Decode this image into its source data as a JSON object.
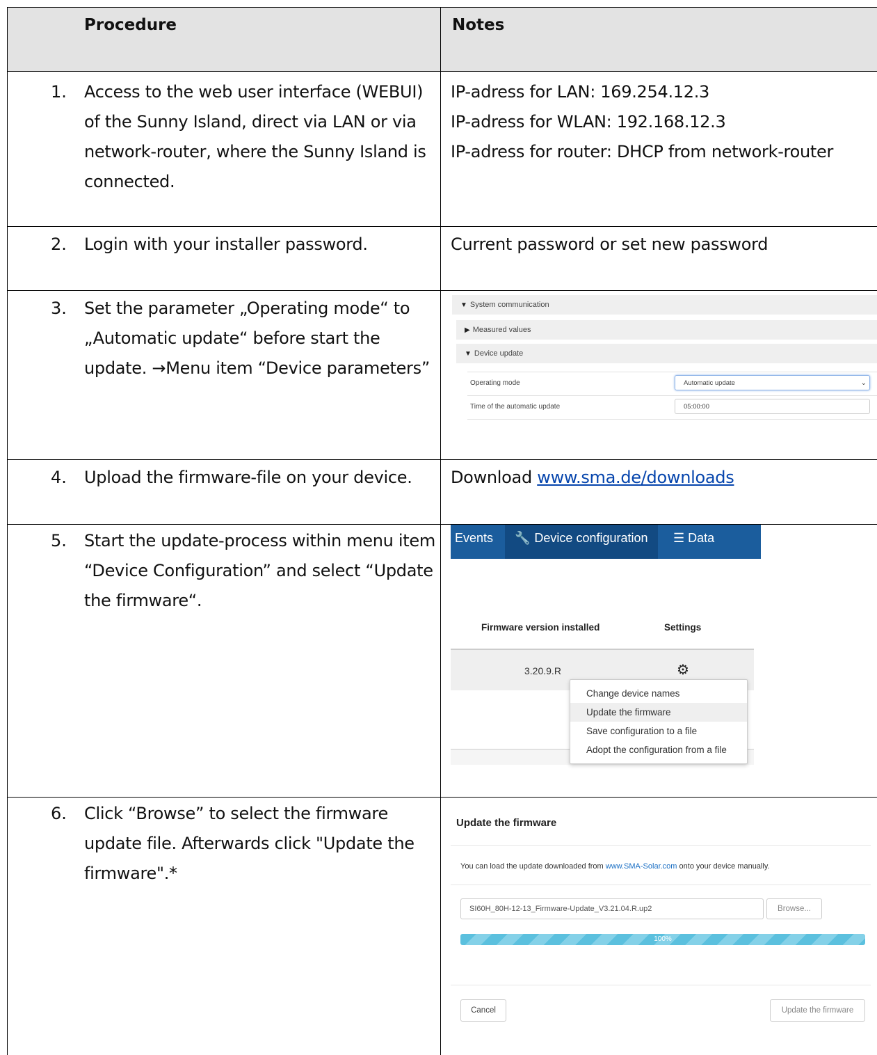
{
  "table": {
    "header": {
      "procedure": "Procedure",
      "notes": "Notes"
    },
    "steps": [
      {
        "num": "1.",
        "text": "Access to the web user interface (WEBUI) of the Sunny Island, direct via LAN or via network-router, where the Sunny Island is connected.",
        "notes": [
          "IP-adress for LAN: 169.254.12.3",
          "IP-adress for WLAN: 192.168.12.3",
          "IP-adress for router: DHCP from network-router"
        ]
      },
      {
        "num": "2.",
        "text": "Login with your installer password.",
        "notes": [
          "Current password or set new password"
        ]
      },
      {
        "num": "3.",
        "text": "Set the parameter „Operating mode“ to „Automatic update“ before start the update. →Menu item “Device parameters”"
      },
      {
        "num": "4.",
        "text": "Upload the firmware-file on your device.",
        "note_prefix": "Download ",
        "note_link": "www.sma.de/downloads"
      },
      {
        "num": "5.",
        "text": "Start the update-process within menu item “Device Configuration” and select “Update the firmware“."
      },
      {
        "num": "6.",
        "text": "Click “Browse” to select the firmware update file.  Afterwards click \"Update the firmware\".*"
      }
    ]
  },
  "step3_ui": {
    "system_communication": "System communication",
    "measured_values": "Measured values",
    "device_update": "Device update",
    "operating_mode_label": "Operating mode",
    "operating_mode_value": "Automatic update",
    "time_label": "Time of the automatic update",
    "time_value": "05:00:00"
  },
  "step5_ui": {
    "nav": {
      "events": "Events",
      "device_configuration": "Device configuration",
      "data": "Data"
    },
    "col_firmware": "Firmware version installed",
    "col_settings": "Settings",
    "firmware_version": "3.20.9.R",
    "menu": [
      "Change device names",
      "Update the firmware",
      "Save configuration to a file",
      "Adopt the configuration from a file"
    ]
  },
  "step6_ui": {
    "title": "Update the firmware",
    "desc_prefix": "You can load the update downloaded from ",
    "desc_link": "www.SMA-Solar.com",
    "desc_suffix": " onto your device manually.",
    "file_name": "SI60H_80H-12-13_Firmware-Update_V3.21.04.R.up2",
    "browse": "Browse...",
    "progress_label": "100%",
    "progress_fraction": 1.0,
    "cancel": "Cancel",
    "update": "Update the firmware"
  },
  "colors": {
    "nav_bg": "#1b5d9d",
    "nav_active": "#124a82",
    "progress": "#5bc0de",
    "link": "#0645ad"
  }
}
